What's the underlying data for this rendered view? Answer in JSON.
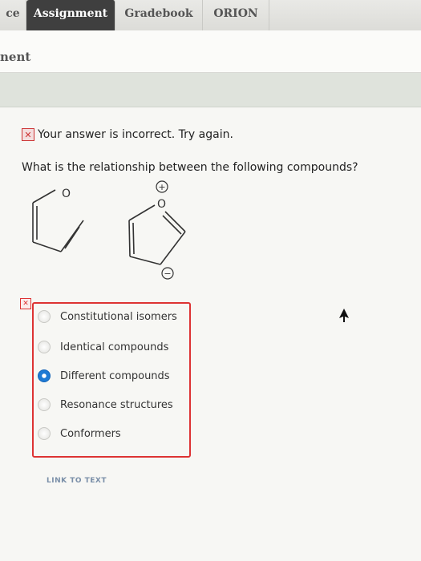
{
  "tabs": [
    {
      "label": "ce"
    },
    {
      "label": "Assignment"
    },
    {
      "label": "Gradebook"
    },
    {
      "label": "ORION"
    }
  ],
  "subheader": {
    "title": "nent"
  },
  "feedback": {
    "message": "Your answer is incorrect.  Try again."
  },
  "question": {
    "text": "What is the relationship between the following compounds?"
  },
  "molecules": {
    "left_atom": "O",
    "right_atom": "O",
    "plus_symbol": "+",
    "minus_symbol": "−"
  },
  "options": [
    {
      "label": "Constitutional isomers",
      "selected": false
    },
    {
      "label": "Identical compounds",
      "selected": false
    },
    {
      "label": "Different compounds",
      "selected": true
    },
    {
      "label": "Resonance structures",
      "selected": false
    },
    {
      "label": "Conformers",
      "selected": false
    }
  ],
  "link": {
    "label": "LINK TO TEXT"
  },
  "colors": {
    "error": "#dd3333",
    "selected": "#1e7ad4",
    "active_tab": "#3f3f3f"
  }
}
